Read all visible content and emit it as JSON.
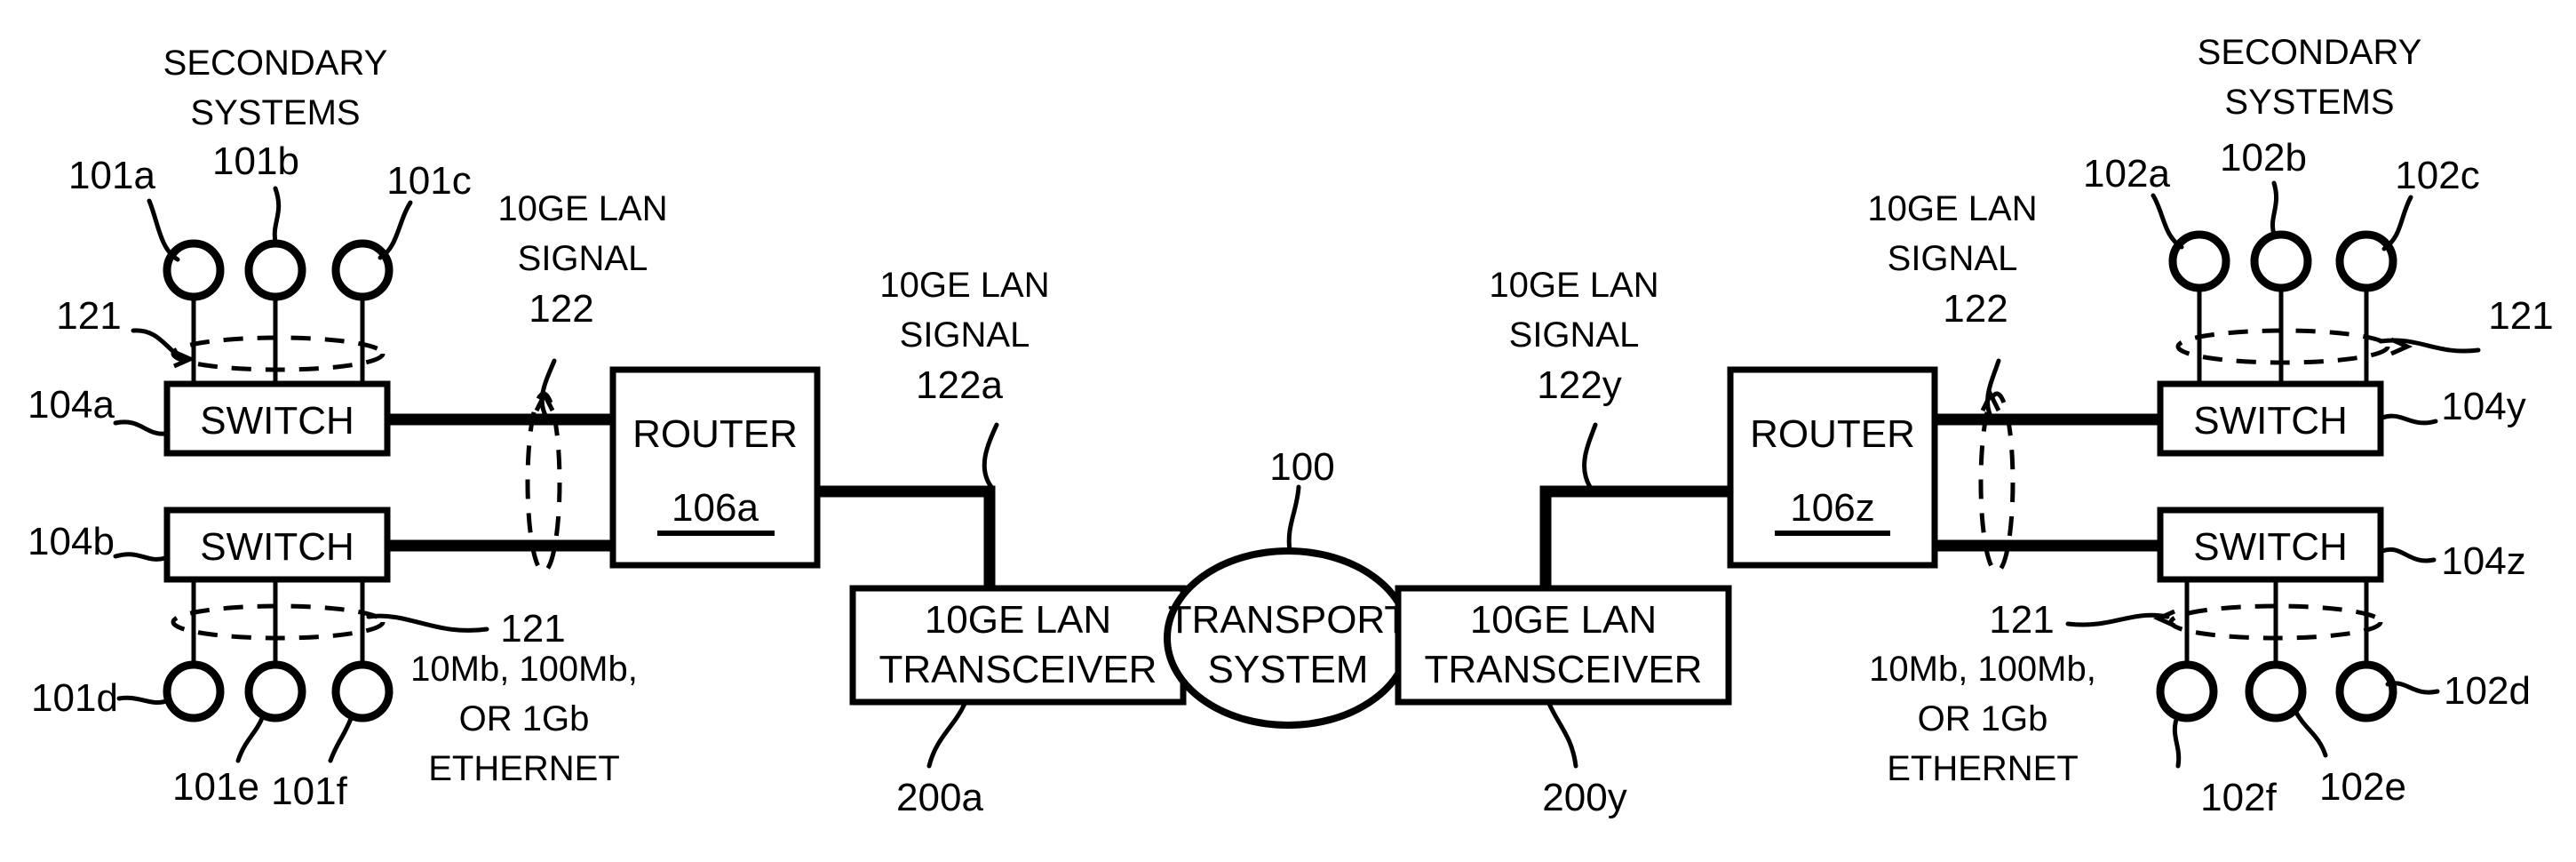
{
  "figure": {
    "type": "patent-network-diagram",
    "background": "#ffffff",
    "ink": "#000000"
  },
  "headings": {
    "secondary_systems_left_line1": "SECONDARY",
    "secondary_systems_left_line2": "SYSTEMS",
    "secondary_systems_right_line1": "SECONDARY",
    "secondary_systems_right_line2": "SYSTEMS"
  },
  "boxes": {
    "switch_104a": "SWITCH",
    "switch_104b": "SWITCH",
    "switch_104y": "SWITCH",
    "switch_104z": "SWITCH",
    "router_left_title": "ROUTER",
    "router_left_ref": "106a",
    "router_right_title": "ROUTER",
    "router_right_ref": "106z",
    "transceiver_left_line1": "10GE LAN",
    "transceiver_left_line2": "TRANSCEIVER",
    "transceiver_right_line1": "10GE LAN",
    "transceiver_right_line2": "TRANSCEIVER",
    "transport_line1": "TRANSPORT",
    "transport_line2": "SYSTEM"
  },
  "reference_numerals": {
    "transport_system": "100",
    "node_101a": "101a",
    "node_101b": "101b",
    "node_101c": "101c",
    "node_101d": "101d",
    "node_101e": "101e",
    "node_101f": "101f",
    "node_102a": "102a",
    "node_102b": "102b",
    "node_102c": "102c",
    "node_102d": "102d",
    "node_102e": "102e",
    "node_102f": "102f",
    "switch_104a": "104a",
    "switch_104b": "104b",
    "switch_104y": "104y",
    "switch_104z": "104z",
    "link_121_top_left": "121",
    "link_121_bottom_left": "121",
    "link_121_top_right": "121",
    "link_121_bottom_right": "121",
    "transceiver_200a": "200a",
    "transceiver_200y": "200y"
  },
  "signal_labels": {
    "left_inner": {
      "line1": "10GE LAN",
      "line2": "SIGNAL",
      "ref": "122"
    },
    "left_outer": {
      "line1": "10GE LAN",
      "line2": "SIGNAL",
      "ref": "122a"
    },
    "right_outer": {
      "line1": "10GE LAN",
      "line2": "SIGNAL",
      "ref": "122y"
    },
    "right_inner": {
      "line1": "10GE LAN",
      "line2": "SIGNAL",
      "ref": "122"
    }
  },
  "ethernet_notes": {
    "left": {
      "line1": "10Mb, 100Mb,",
      "line2": "OR 1Gb",
      "line3": "ETHERNET"
    },
    "right": {
      "line1": "10Mb, 100Mb,",
      "line2": "OR 1Gb",
      "line3": "ETHERNET"
    }
  }
}
